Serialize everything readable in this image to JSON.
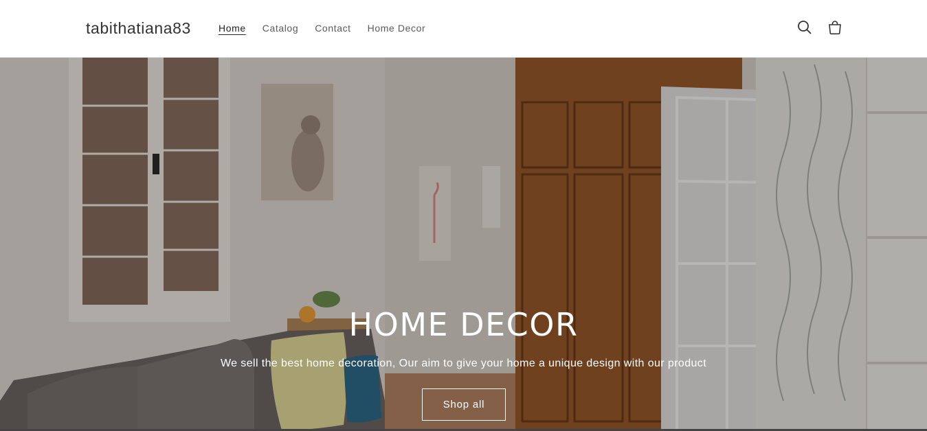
{
  "header": {
    "store_name": "tabithatiana83",
    "nav": [
      {
        "label": "Home"
      },
      {
        "label": "Catalog"
      },
      {
        "label": "Contact"
      },
      {
        "label": "Home Decor"
      }
    ],
    "icons": {
      "search": "search-icon",
      "cart": "cart-icon"
    }
  },
  "hero": {
    "title": "HOME DECOR",
    "subtitle": "We sell the best home decoration, Our aim to give your home a unique design with our product",
    "button_label": "Shop all"
  },
  "colors": {
    "header_bg": "#ffffff",
    "text": "#333333",
    "hero_text": "#ffffff"
  }
}
